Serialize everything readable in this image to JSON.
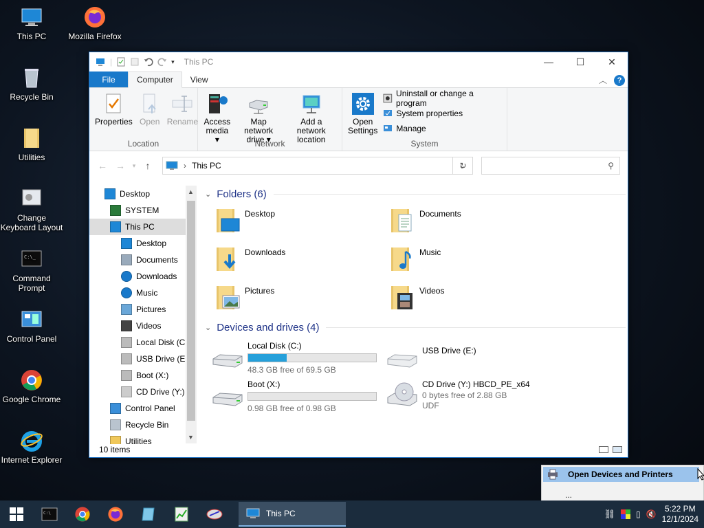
{
  "desktop": {
    "icons": [
      {
        "label": "This PC",
        "icon": "computer-icon"
      },
      {
        "label": "Mozilla Firefox",
        "icon": "firefox-icon"
      },
      {
        "label": "Recycle Bin",
        "icon": "recycle-bin-icon"
      },
      {
        "label": "Utilities",
        "icon": "folder-icon"
      },
      {
        "label": "Change Keyboard Layout",
        "icon": "keyboard-icon"
      },
      {
        "label": "Command Prompt",
        "icon": "cmd-icon"
      },
      {
        "label": "Control Panel",
        "icon": "control-panel-icon"
      },
      {
        "label": "Google Chrome",
        "icon": "chrome-icon"
      },
      {
        "label": "Internet Explorer",
        "icon": "ie-icon"
      }
    ]
  },
  "window": {
    "title": "This PC",
    "tabs": {
      "file": "File",
      "computer": "Computer",
      "view": "View"
    },
    "ribbon": {
      "location": {
        "label": "Location",
        "properties": "Properties",
        "open": "Open",
        "rename": "Rename"
      },
      "network": {
        "label": "Network",
        "access_media_1": "Access",
        "access_media_2": "media ▾",
        "map_drive_1": "Map network",
        "map_drive_2": "drive ▾",
        "add_location_1": "Add a network",
        "add_location_2": "location"
      },
      "system": {
        "label": "System",
        "open_settings_1": "Open",
        "open_settings_2": "Settings",
        "uninstall": "Uninstall or change a program",
        "sys_props": "System properties",
        "manage": "Manage"
      }
    },
    "address": {
      "path": "This PC",
      "search_placeholder": ""
    },
    "nav": {
      "items": [
        {
          "label": "Desktop",
          "indent": 0,
          "icon": "desktop-icon"
        },
        {
          "label": "SYSTEM",
          "indent": 1,
          "icon": "user-icon"
        },
        {
          "label": "This PC",
          "indent": 1,
          "icon": "computer-icon",
          "selected": true
        },
        {
          "label": "Desktop",
          "indent": 2,
          "icon": "desktop-icon"
        },
        {
          "label": "Documents",
          "indent": 2,
          "icon": "documents-icon"
        },
        {
          "label": "Downloads",
          "indent": 2,
          "icon": "downloads-icon"
        },
        {
          "label": "Music",
          "indent": 2,
          "icon": "music-icon"
        },
        {
          "label": "Pictures",
          "indent": 2,
          "icon": "pictures-icon"
        },
        {
          "label": "Videos",
          "indent": 2,
          "icon": "videos-icon"
        },
        {
          "label": "Local Disk (C:)",
          "indent": 2,
          "icon": "drive-icon"
        },
        {
          "label": "USB Drive (E:)",
          "indent": 2,
          "icon": "drive-icon"
        },
        {
          "label": "Boot (X:)",
          "indent": 2,
          "icon": "drive-icon"
        },
        {
          "label": "CD Drive (Y:) H",
          "indent": 2,
          "icon": "cd-icon"
        },
        {
          "label": "Control Panel",
          "indent": 1,
          "icon": "control-panel-icon"
        },
        {
          "label": "Recycle Bin",
          "indent": 1,
          "icon": "recycle-bin-icon"
        },
        {
          "label": "Utilities",
          "indent": 1,
          "icon": "folder-icon"
        }
      ]
    },
    "folders_header": "Folders (6)",
    "folders": [
      {
        "label": "Desktop"
      },
      {
        "label": "Documents"
      },
      {
        "label": "Downloads"
      },
      {
        "label": "Music"
      },
      {
        "label": "Pictures"
      },
      {
        "label": "Videos"
      }
    ],
    "drives_header": "Devices and drives (4)",
    "drives": {
      "c": {
        "name": "Local Disk (C:)",
        "free": "48.3 GB free of 69.5 GB",
        "used_fraction": 0.3
      },
      "e": {
        "name": "USB Drive (E:)"
      },
      "x": {
        "name": "Boot (X:)",
        "free": "0.98 GB free of 0.98 GB",
        "used_fraction": 0.0
      },
      "y": {
        "name": "CD Drive (Y:) HBCD_PE_x64",
        "free": "0 bytes free of 2.88 GB",
        "fs": "UDF"
      }
    },
    "status": "10 items"
  },
  "popup": {
    "item": "Open Devices and Printers",
    "more": "..."
  },
  "taskbar": {
    "task_label": "This PC",
    "time": "5:22 PM",
    "date": "12/1/2024"
  },
  "colors": {
    "accent": "#1979ca",
    "bar": "#26a0da",
    "taskbar": "#1b2c3d"
  }
}
